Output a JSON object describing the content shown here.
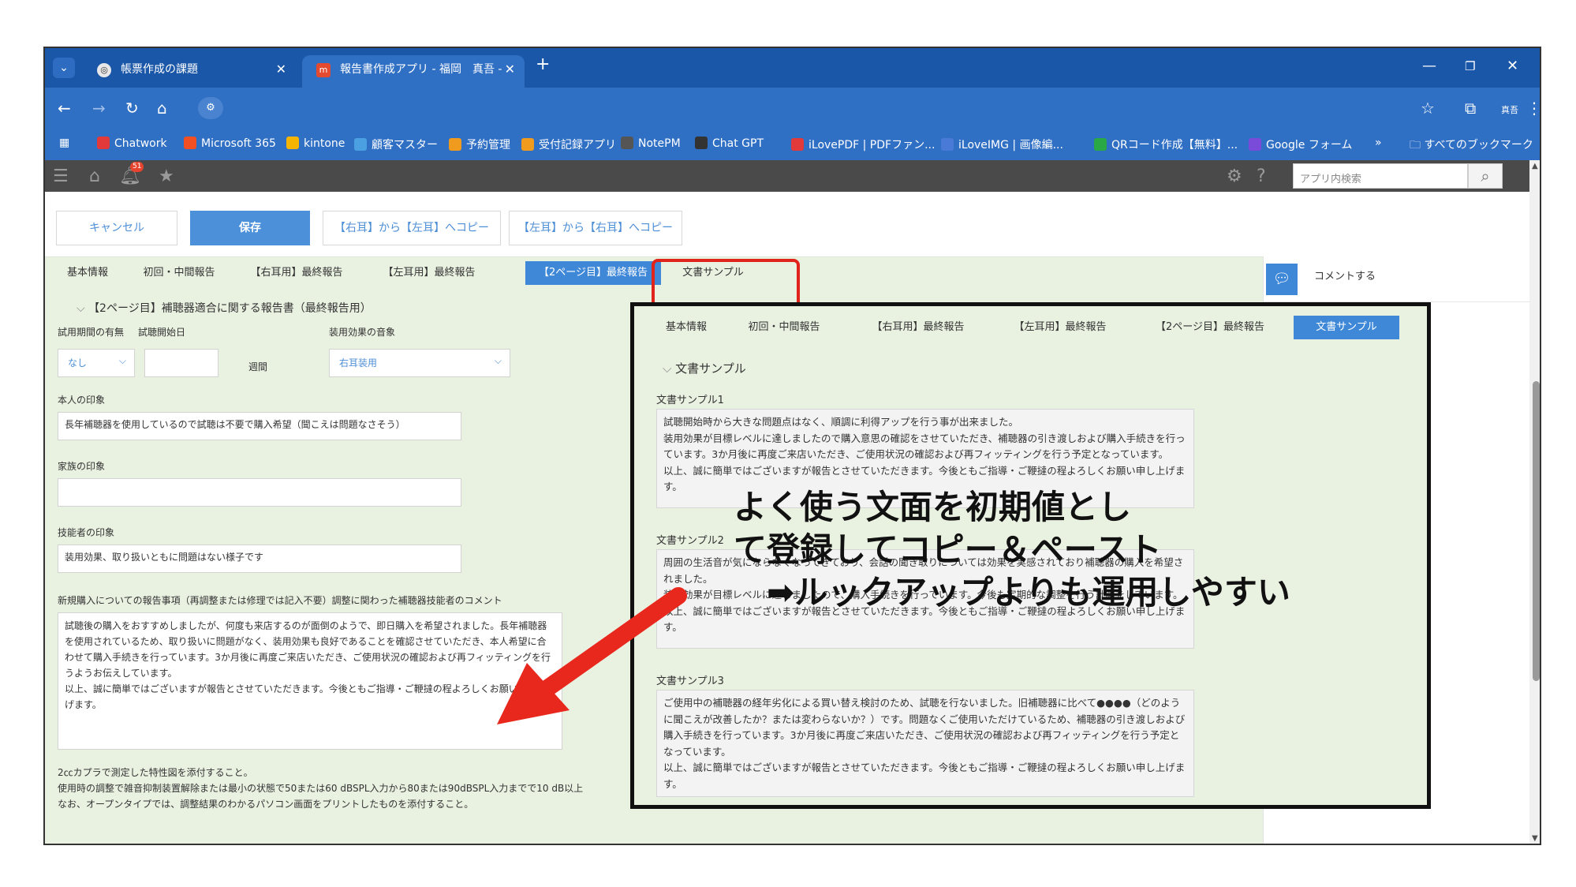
{
  "browser": {
    "tabs": [
      {
        "title": "帳票作成の課題",
        "icon": "chrome-icon"
      },
      {
        "title": "報告書作成アプリ - 福岡　真吾 -",
        "icon": "kintone-app-icon"
      }
    ],
    "profile_label": "真吾",
    "bookmarks": [
      {
        "label": "Chatwork",
        "icon": "chatwork-icon",
        "color": "#e23a3a"
      },
      {
        "label": "Microsoft 365",
        "icon": "microsoft-icon",
        "color": "#f25022"
      },
      {
        "label": "kintone",
        "icon": "kintone-icon",
        "color": "#f5b400"
      },
      {
        "label": "顧客マスター",
        "icon": "app-icon",
        "color": "#4aa0e0"
      },
      {
        "label": "予約管理",
        "icon": "app-icon",
        "color": "#f09a1e"
      },
      {
        "label": "受付記録アプリ",
        "icon": "app-icon",
        "color": "#f09a1e"
      },
      {
        "label": "NotePM",
        "icon": "notepm-icon",
        "color": "#555555"
      },
      {
        "label": "Chat GPT",
        "icon": "chatgpt-icon",
        "color": "#333333"
      },
      {
        "label": "iLovePDF | PDFファン...",
        "icon": "heart-icon",
        "color": "#e23a3a"
      },
      {
        "label": "iLoveIMG | 画像編...",
        "icon": "heart-icon",
        "color": "#4a7ad8"
      },
      {
        "label": "QRコード作成【無料】...",
        "icon": "qr-icon",
        "color": "#2aa845"
      },
      {
        "label": "Google フォーム",
        "icon": "forms-icon",
        "color": "#7a4ad8"
      }
    ],
    "all_bookmarks_label": "すべてのブックマーク"
  },
  "app_header": {
    "notification_count": "51",
    "search_placeholder": "アプリ内検索"
  },
  "toolbar": {
    "cancel_label": "キャンセル",
    "save_label": "保存",
    "copy_r_to_l_label": "【右耳】から【左耳】へコピー",
    "copy_l_to_r_label": "【左耳】から【右耳】へコピー"
  },
  "form": {
    "tabs": [
      "基本情報",
      "初回・中間報告",
      "【右耳用】最終報告",
      "【左耳用】最終報告",
      "【2ページ目】最終報告",
      "文書サンプル"
    ],
    "active_tab_index": 4,
    "section_title": "【2ページ目】補聴器適合に関する報告書（最終報告用）",
    "trial_period_label": "試用期間の有無",
    "trial_start_label": "試聴開始日",
    "trial_value": "なし",
    "weeks_label": "週間",
    "wearing_effect_label": "装用効果の音象",
    "wearing_effect_value": "右耳装用",
    "self_impression_label": "本人の印象",
    "self_impression_value": "長年補聴器を使用しているので試聴は不要で購入希望（聞こえは問題なさそう）",
    "family_impression_label": "家族の印象",
    "family_impression_value": "",
    "tech_impression_label": "技能者の印象",
    "tech_impression_value": "装用効果、取り扱いともに問題はない様子です",
    "new_purchase_label": "新規購入についての報告事項（再調整または修理では記入不要）調整に関わった補聴器技能者のコメント",
    "new_purchase_value": "試聴後の購入をおすすめしましたが、何度も来店するのが面倒のようで、即日購入を希望されました。長年補聴器を使用されているため、取り扱いに問題がなく、装用効果も良好であることを確認させていただき、本人希望に合わせて購入手続きを行っています。3か月後に再度ご来店いただき、ご使用状況の確認および再フィッティングを行うようお伝えしています。\n以上、誠に簡単ではございますが報告とさせていただきます。今後ともご指導・ご鞭撻の程よろしくお願い申し上げます。",
    "notes": [
      "2㏄カプラで測定した特性図を添付すること。",
      "使用時の調整で雑音抑制装置解除または最小の状態で50または60 dBSPL入力から80または90dBSPL入力までで10 dB以上",
      "なお、オープンタイプでは、調整結果のわかるパソコン画面をプリントしたものを添付すること。"
    ]
  },
  "comment_panel": {
    "comment_label": "コメントする"
  },
  "inset": {
    "tabs": [
      "基本情報",
      "初回・中間報告",
      "【右耳用】最終報告",
      "【左耳用】最終報告",
      "【2ページ目】最終報告",
      "文書サンプル"
    ],
    "active_tab_index": 5,
    "section_title": "文書サンプル",
    "samples": [
      {
        "label": "文書サンプル1",
        "text": "試聴開始時から大きな問題点はなく、順調に利得アップを行う事が出来ました。\n装用効果が目標レベルに達しましたので購入意思の確認をさせていただき、補聴器の引き渡しおよび購入手続きを行っています。3か月後に再度ご来店いただき、ご使用状況の確認および再フィッティングを行う予定となっています。\n以上、誠に簡単ではございますが報告とさせていただきます。今後ともご指導・ご鞭撻の程よろしくお願い申し上げます。"
      },
      {
        "label": "文書サンプル2",
        "text": "周囲の生活音が気にならなくなってきており、会話の聞き取りについては効果を実感されており補聴器の購入を希望されました。\n装用効果が目標レベルに達しましたので、購入手続きを行っています。今後も定期的な調整を行う計画をしています。\n以上、誠に簡単ではございますが報告とさせていただきます。今後ともご指導・ご鞭撻の程よろしくお願い申し上げます。"
      },
      {
        "label": "文書サンプル3",
        "text": "ご使用中の補聴器の経年劣化による買い替え検討のため、試聴を行ないました。旧補聴器に比べて●●●●（どのように聞こえが改善したか？または変わらないか？）です。問題なくご使用いただけているため、補聴器の引き渡しおよび購入手続きを行っています。3か月後に再度ご来店いただき、ご使用状況の確認および再フィッティングを行う予定となっています。\n以上、誠に簡単ではございますが報告とさせていただきます。今後ともご指導・ご鞭撻の程よろしくお願い申し上げます。"
      }
    ]
  },
  "callout": {
    "text": "よく使う文面を初期値として登録してコピー＆ペースト\n➡ルックアップよりも運用しやすい"
  },
  "colors": {
    "chrome_blue": "#1a57a8",
    "accent_blue": "#3f88d8",
    "form_bg": "#e9f1e1",
    "highlight_red": "#e0241b",
    "arrow_red": "#e8281d"
  }
}
